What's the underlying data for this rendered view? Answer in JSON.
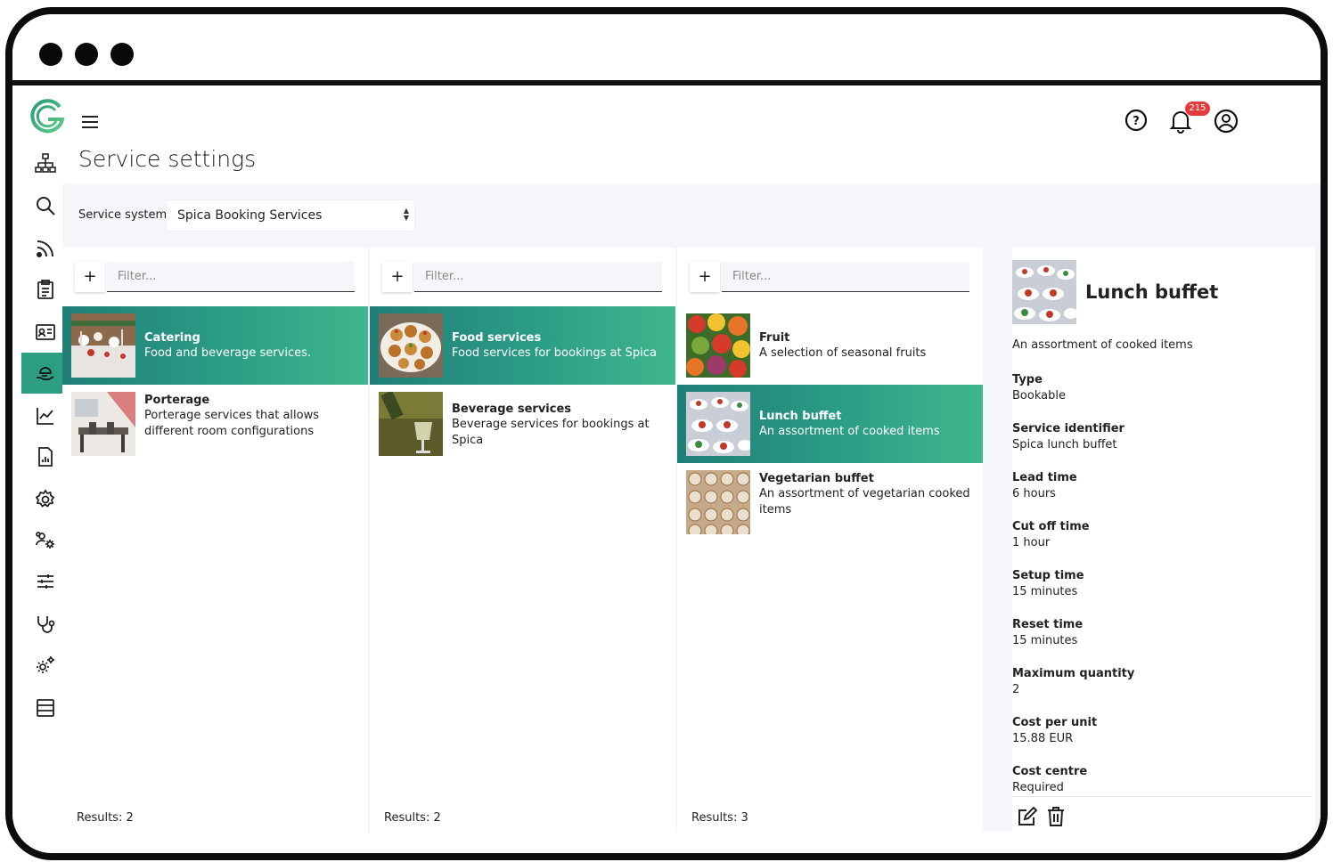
{
  "header": {
    "title": "Service settings",
    "notification_count": "215"
  },
  "sidebar": {
    "items": [
      "sitemap-icon",
      "search-icon",
      "feed-icon",
      "clipboard-icon",
      "id-card-icon",
      "service-hand-icon",
      "chart-icon",
      "report-icon",
      "settings-icon",
      "users-settings-icon",
      "sliders-icon",
      "stethoscope-icon",
      "cogs-icon",
      "server-icon"
    ],
    "active_item": "service-hand-icon"
  },
  "service_system": {
    "label": "Service system",
    "selected": "Spica Booking Services"
  },
  "filter": {
    "placeholder": "Filter..."
  },
  "columns": [
    {
      "items": [
        {
          "title": "Catering",
          "description": "Food and beverage services.",
          "selected": true
        },
        {
          "title": "Porterage",
          "description": "Porterage services that allows different room configurations",
          "selected": false
        }
      ],
      "results": "Results: 2"
    },
    {
      "items": [
        {
          "title": "Food services",
          "description": "Food services for bookings at Spica",
          "selected": true
        },
        {
          "title": "Beverage services",
          "description": "Beverage services for bookings at Spica",
          "selected": false
        }
      ],
      "results": "Results: 2"
    },
    {
      "items": [
        {
          "title": "Fruit",
          "description": "A selection of seasonal fruits",
          "selected": false
        },
        {
          "title": "Lunch buffet",
          "description": "An assortment of cooked items",
          "selected": true
        },
        {
          "title": "Vegetarian buffet",
          "description": "An assortment of vegetarian cooked items",
          "selected": false
        }
      ],
      "results": "Results: 3"
    }
  ],
  "detail": {
    "title": "Lunch buffet",
    "description": "An assortment of cooked items",
    "fields": [
      {
        "label": "Type",
        "value": "Bookable"
      },
      {
        "label": "Service identifier",
        "value": "Spica lunch buffet"
      },
      {
        "label": "Lead time",
        "value": "6 hours"
      },
      {
        "label": "Cut off time",
        "value": "1 hour"
      },
      {
        "label": "Setup time",
        "value": "15 minutes"
      },
      {
        "label": "Reset time",
        "value": "15 minutes"
      },
      {
        "label": "Maximum quantity",
        "value": "2"
      },
      {
        "label": "Cost per unit",
        "value": "15.88 EUR"
      },
      {
        "label": "Cost centre",
        "value": "Required"
      }
    ],
    "actions": [
      "edit-icon",
      "delete-icon"
    ]
  },
  "colors": {
    "accent": "#2e9e82",
    "selected_gradient_start": "#1f7f77",
    "selected_gradient_end": "#3fb68c",
    "badge": "#e53b3b"
  }
}
